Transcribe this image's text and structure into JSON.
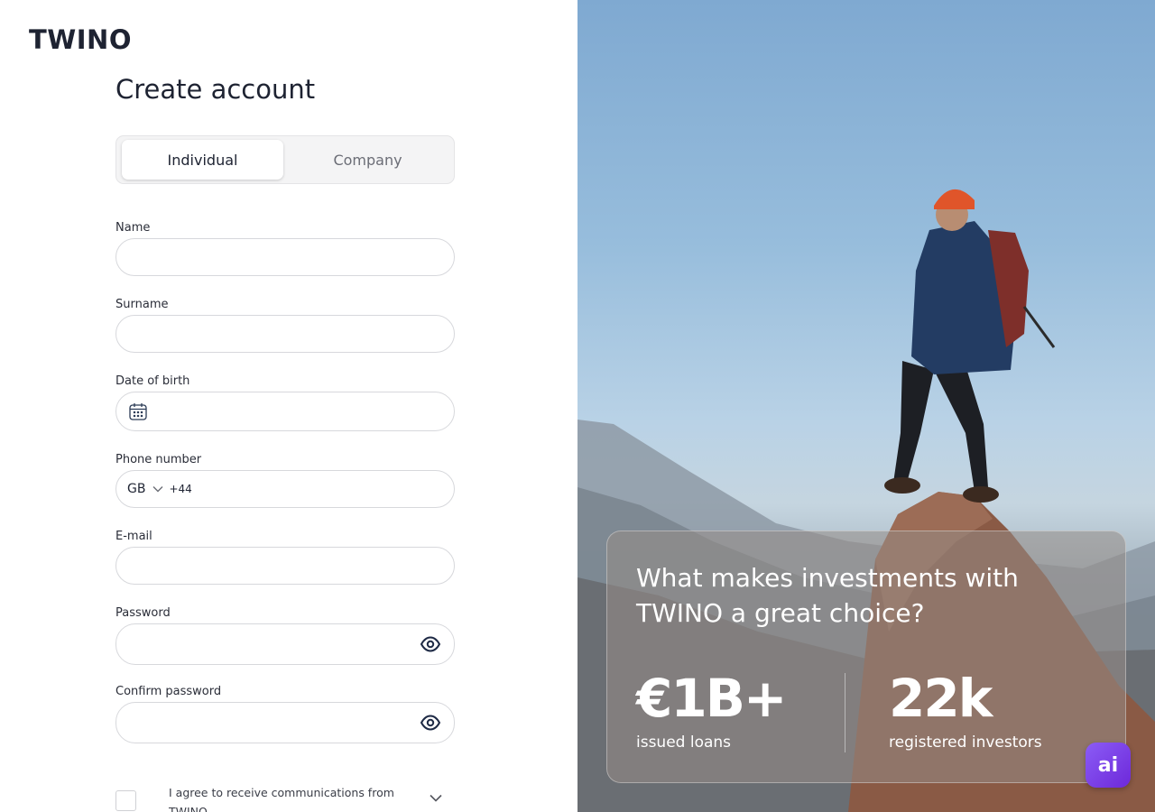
{
  "brand": {
    "logo": "TWINO"
  },
  "form": {
    "title": "Create account",
    "account_type": {
      "options": [
        "Individual",
        "Company"
      ],
      "selected": "Individual"
    },
    "fields": {
      "name": {
        "label": "Name",
        "value": ""
      },
      "surname": {
        "label": "Surname",
        "value": ""
      },
      "date_of_birth": {
        "label": "Date of birth",
        "value": ""
      },
      "phone": {
        "label": "Phone number",
        "country": "GB",
        "dial_code": "+44",
        "value": ""
      },
      "email": {
        "label": "E-mail",
        "value": ""
      },
      "password": {
        "label": "Password",
        "value": ""
      },
      "confirm_password": {
        "label": "Confirm password",
        "value": ""
      }
    },
    "consent": {
      "text": "I agree to receive communications from TWINO",
      "checked": false
    }
  },
  "promo": {
    "title": "What makes investments with TWINO a great choice?",
    "stats": [
      {
        "value": "€1B+",
        "label": "issued loans"
      },
      {
        "value": "22k",
        "label": "registered investors"
      }
    ]
  },
  "assistant": {
    "label": "ai"
  },
  "colors": {
    "text": "#1e2332",
    "border": "#d7d8dc",
    "assistant": "#7c3aed"
  }
}
